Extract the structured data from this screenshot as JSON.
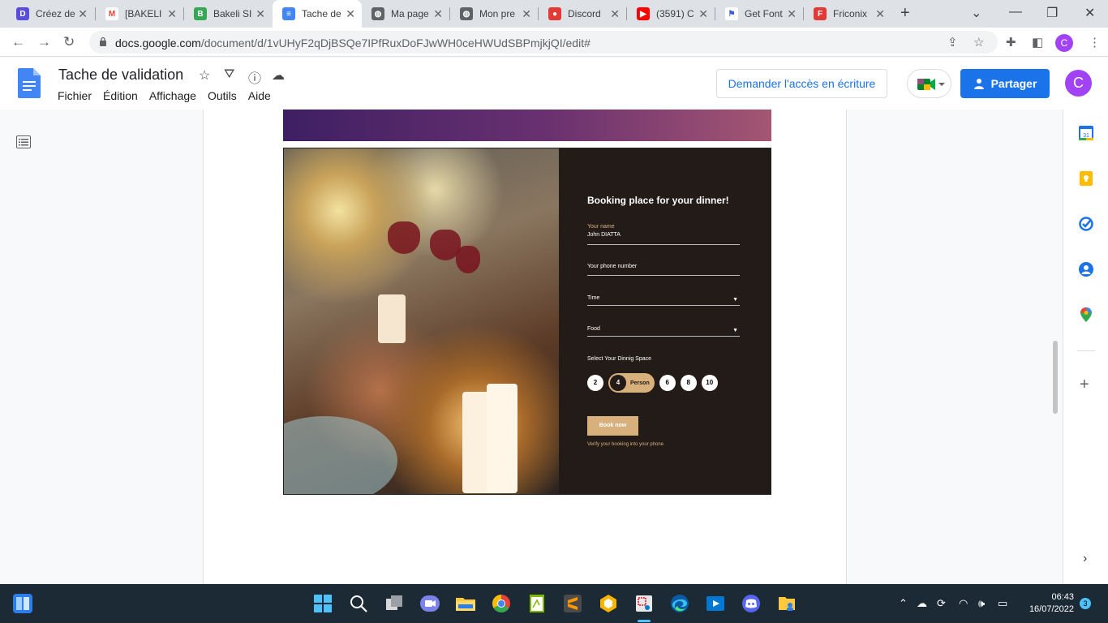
{
  "browser": {
    "tabs": [
      {
        "title": "Créez de",
        "color": "#5b4ce0",
        "icon": "lettering-app-icon"
      },
      {
        "title": "[BAKELI",
        "color": "#ea4335",
        "icon": "gmail-icon"
      },
      {
        "title": "Bakeli SI",
        "color": "#34a853",
        "icon": "bakeli-icon"
      },
      {
        "title": "Tache de",
        "color": "#4285f4",
        "icon": "docs-icon"
      },
      {
        "title": "Ma page",
        "color": "#5f6368",
        "icon": "globe-icon"
      },
      {
        "title": "Mon pre",
        "color": "#5f6368",
        "icon": "globe-icon"
      },
      {
        "title": "Discord",
        "color": "#e53935",
        "icon": "discord-icon"
      },
      {
        "title": "(3591) C",
        "color": "#ff0000",
        "icon": "youtube-icon"
      },
      {
        "title": "Get Font",
        "color": "#3b5bdb",
        "icon": "flag-icon"
      },
      {
        "title": "Friconix",
        "color": "#e53935",
        "icon": "friconix-icon"
      }
    ],
    "url_host": "docs.google.com",
    "url_path": "/document/d/1vUHyF2qDjBSQe7IPfRuxDoFJwWH0ceHWUdSBPmjkjQI/edit#",
    "profile_initial": "C"
  },
  "docs": {
    "title": "Tache de validation",
    "menu": [
      "Fichier",
      "Édition",
      "Affichage",
      "Outils",
      "Aide"
    ],
    "request_access": "Demander l'accès en écriture",
    "share": "Partager",
    "account_initial": "C"
  },
  "booking": {
    "heading": "Booking place for your dinner!",
    "name_label": "Your name",
    "name_value": "John DIATTA",
    "phone_label": "Your phone number",
    "time_label": "Time",
    "food_label": "Food",
    "space_label": "Select Your Dinnig Space",
    "chip_2": "2",
    "chip_4": "4",
    "chip_person": "Person",
    "chip_6": "6",
    "chip_8": "8",
    "chip_10": "10",
    "book_button": "Book now",
    "verify_text": "Verify your booking into your phone"
  },
  "taskbar": {
    "time": "06:43",
    "date": "16/07/2022",
    "notifications": "3"
  }
}
